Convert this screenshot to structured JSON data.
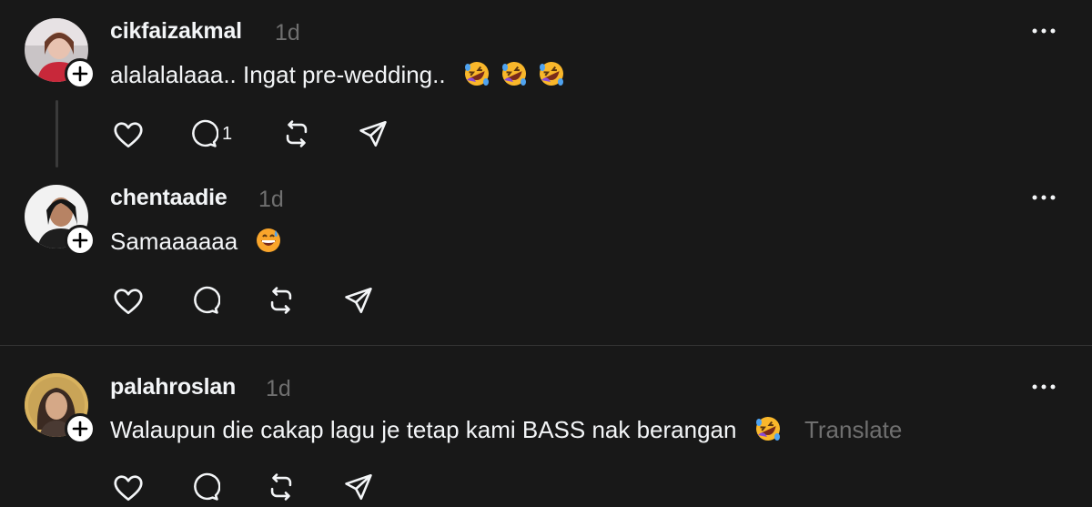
{
  "colors": {
    "background": "#181818",
    "text_primary": "#f3f5f7",
    "text_secondary": "#6f6f6f",
    "divider": "#333333"
  },
  "posts": [
    {
      "username": "cikfaizakmal",
      "time": "1d",
      "text": "alalalalaaa.. Ingat pre-wedding..",
      "emoji": [
        "rolling-on-floor-laughing",
        "rolling-on-floor-laughing",
        "rolling-on-floor-laughing"
      ],
      "reply_count": "1",
      "translate": ""
    },
    {
      "username": "chentaadie",
      "time": "1d",
      "text": "Samaaaaaa",
      "emoji": [
        "grinning-sweat"
      ],
      "reply_count": "",
      "translate": ""
    },
    {
      "username": "palahroslan",
      "time": "1d",
      "text": "Walaupun die cakap lagu je tetap kami BASS nak berangan",
      "emoji": [
        "rolling-on-floor-laughing"
      ],
      "reply_count": "",
      "translate": "Translate"
    }
  ]
}
